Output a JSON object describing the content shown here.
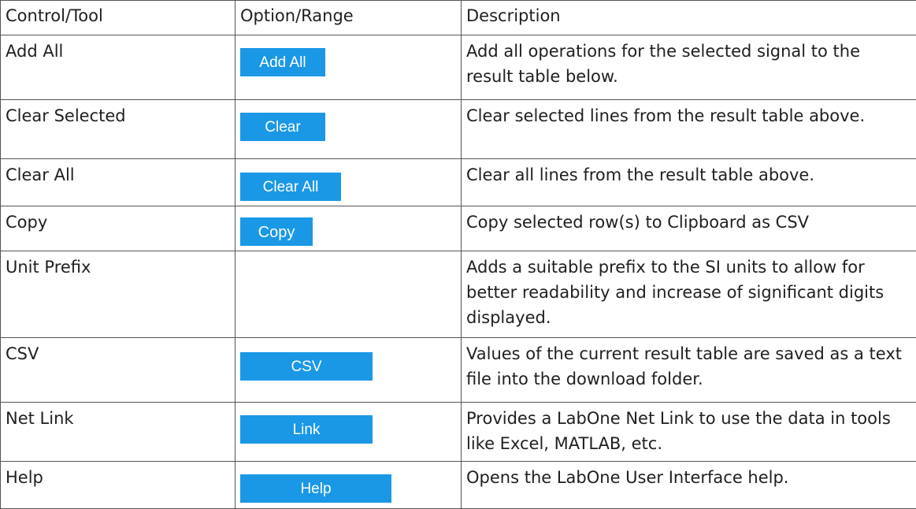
{
  "headers": {
    "control": "Control/Tool",
    "option": "Option/Range",
    "description": "Description"
  },
  "rows": [
    {
      "control": "Add All",
      "button": "Add All",
      "description": "Add all operations for the selected signal to the result table below."
    },
    {
      "control": "Clear Selected",
      "button": "Clear",
      "description": "Clear selected lines from the result table above."
    },
    {
      "control": "Clear All",
      "button": "Clear All",
      "description": "Clear all lines from the result table above."
    },
    {
      "control": "Copy",
      "button": "Copy",
      "description": "Copy selected row(s) to Clipboard as CSV"
    },
    {
      "control": "Unit Prefix",
      "button": "",
      "description": "Adds a suitable prefix to the SI units to allow for better readability and increase of significant digits displayed."
    },
    {
      "control": "CSV",
      "button": "CSV",
      "description": "Values of the current result table are saved as a text file into the download folder."
    },
    {
      "control": "Net Link",
      "button": "Link",
      "description": "Provides a LabOne Net Link to use the data in tools like Excel, MATLAB, etc."
    },
    {
      "control": "Help",
      "button": "Help",
      "description": "Opens the LabOne User Interface help."
    }
  ],
  "colors": {
    "button_bg": "#1a98e6",
    "button_text": "#ffffff",
    "border": "#555555"
  }
}
